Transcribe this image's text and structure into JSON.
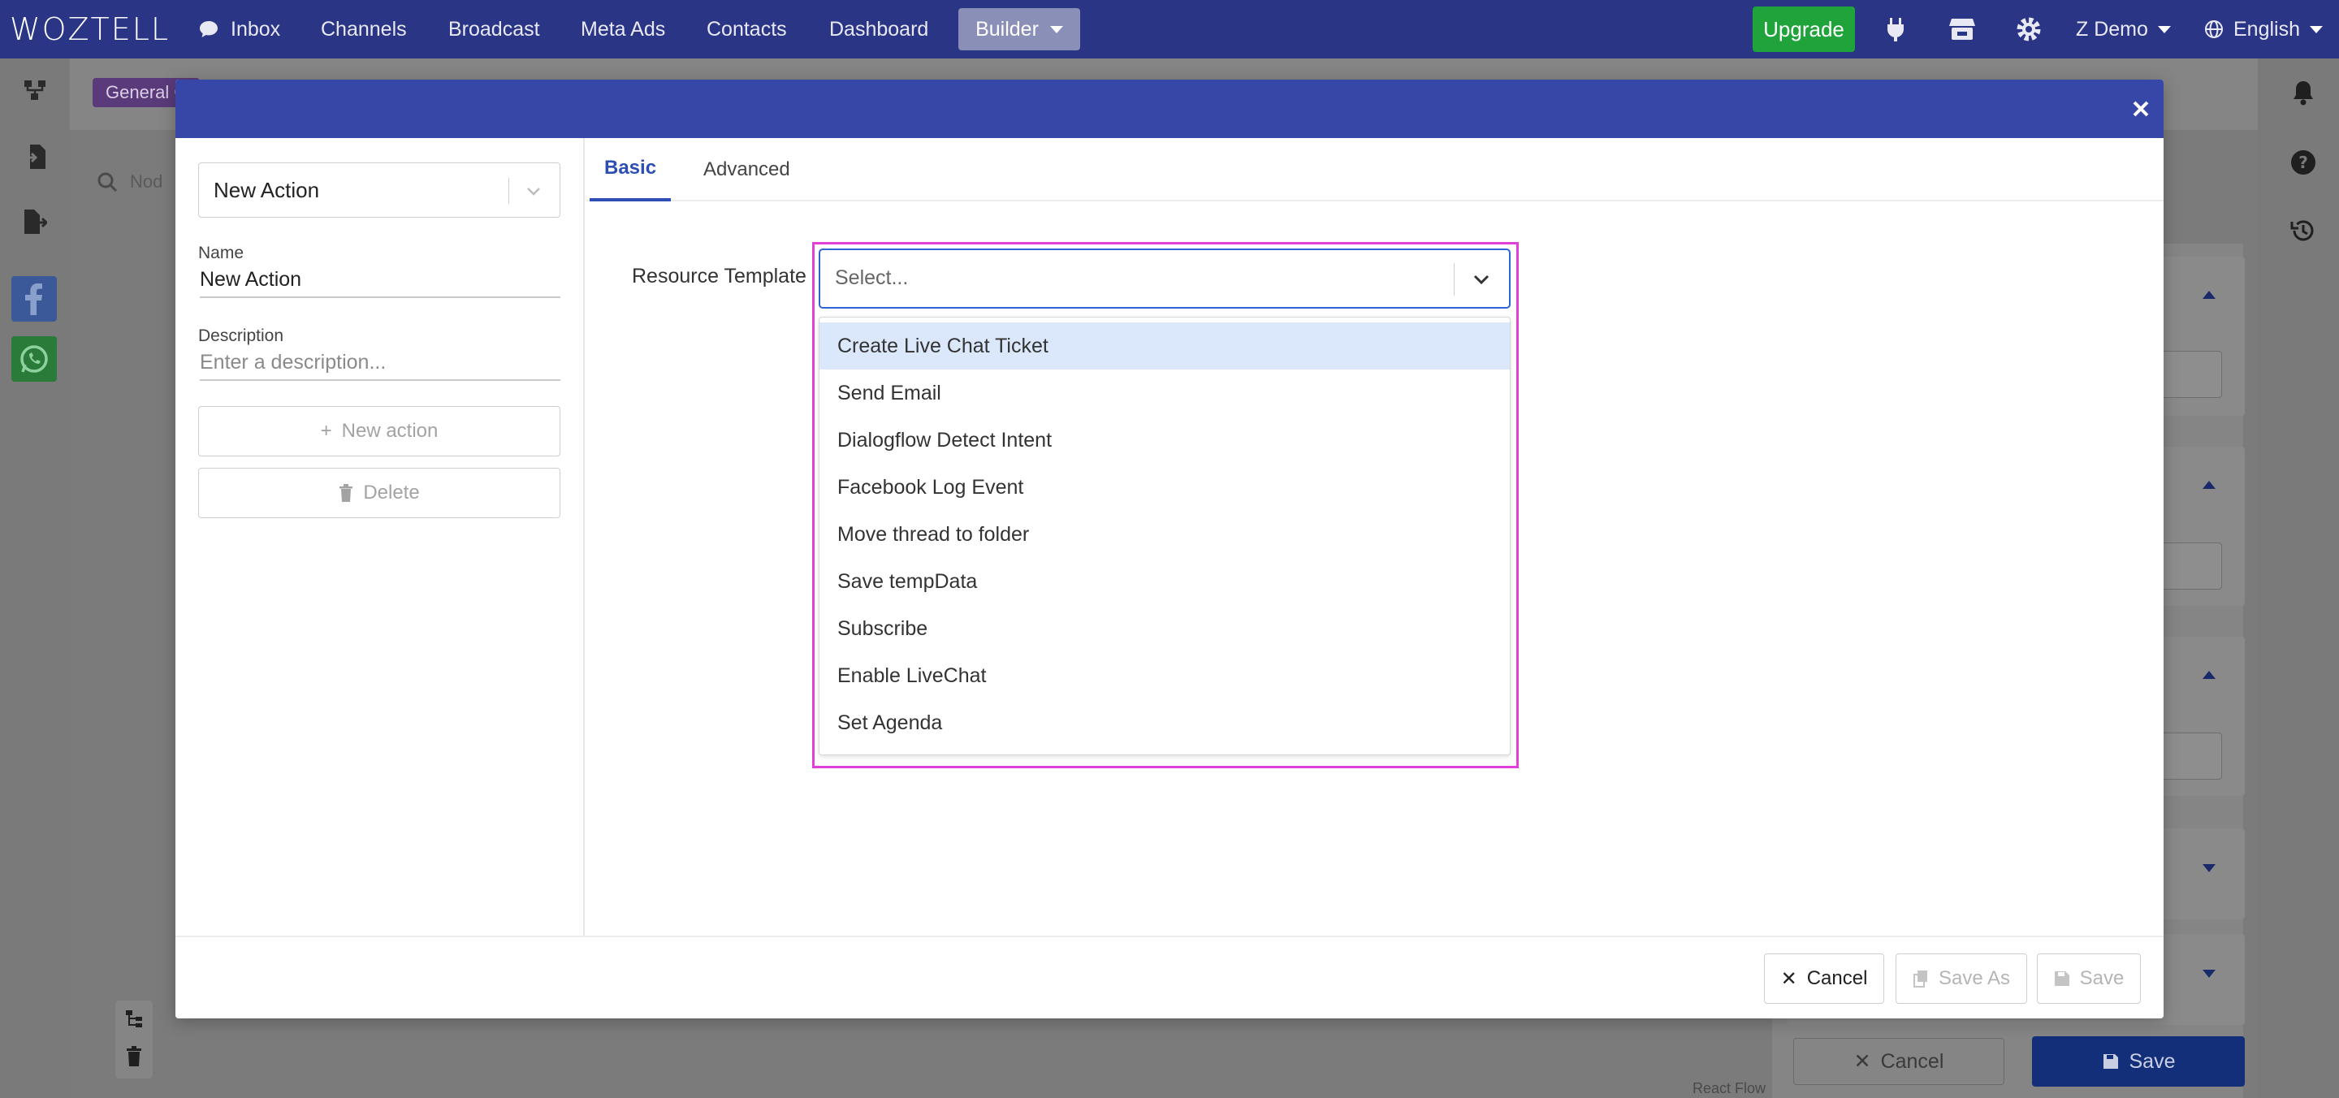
{
  "app": {
    "logo": "WOZTELL"
  },
  "topnav": {
    "items": [
      "Inbox",
      "Channels",
      "Broadcast",
      "Meta Ads",
      "Contacts",
      "Dashboard"
    ],
    "builder_label": "Builder",
    "upgrade_label": "Upgrade",
    "user_label": "Z Demo",
    "language_label": "English"
  },
  "canvas": {
    "badge": "General C",
    "search_placeholder": "Nod",
    "react_flow_label": "React Flow",
    "cancel_label": "Cancel",
    "save_label": "Save"
  },
  "modal": {
    "node_type_value": "New Action",
    "name_label": "Name",
    "name_value": "New Action",
    "description_label": "Description",
    "description_placeholder": "Enter a description...",
    "new_action_label": "New action",
    "delete_label": "Delete",
    "tabs": [
      {
        "label": "Basic",
        "active": true
      },
      {
        "label": "Advanced",
        "active": false
      }
    ],
    "resource_template_label": "Resource Template",
    "resource_template_placeholder": "Select...",
    "options": [
      "Create Live Chat Ticket",
      "Send Email",
      "Dialogflow Detect Intent",
      "Facebook Log Event",
      "Move thread to folder",
      "Save tempData",
      "Subscribe",
      "Enable LiveChat",
      "Set Agenda"
    ],
    "highlighted_option": "Create Live Chat Ticket",
    "footer": {
      "cancel_label": "Cancel",
      "save_as_label": "Save As",
      "save_label": "Save"
    }
  },
  "colors": {
    "nav_bg": "#2b3586",
    "modal_header": "#3647a8",
    "accent_blue": "#2d4fb3",
    "upgrade_green": "#21a33b",
    "highlight_magenta": "#e040d8",
    "option_highlight": "#dbe8fb"
  }
}
